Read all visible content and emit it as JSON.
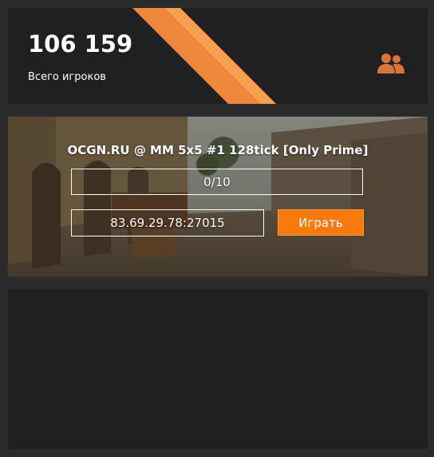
{
  "stats": {
    "player_count": "106 159",
    "players_label": "Всего игроков",
    "icon": "users-icon"
  },
  "server": {
    "name": "OCGN.RU @ MM 5x5 #1 128tick [Only Prime]",
    "slots": "0/10",
    "address": "83.69.29.78:27015",
    "play_label": "Играть"
  },
  "colors": {
    "accent": "#f8790d",
    "card_background": "#202020",
    "page_background": "#2b2b2b"
  }
}
